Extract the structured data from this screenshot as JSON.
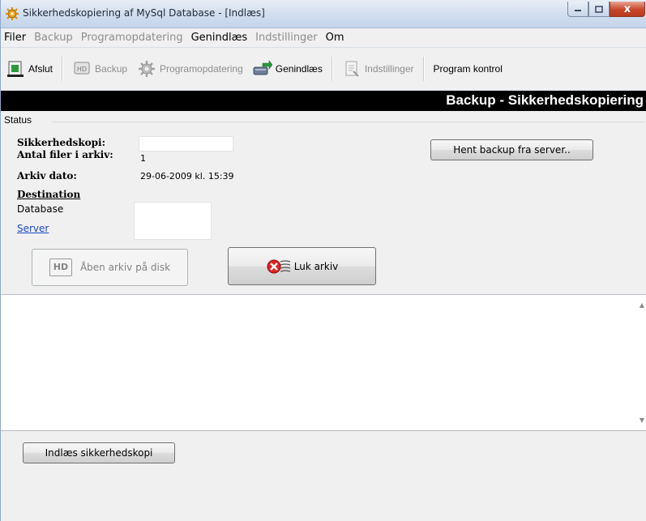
{
  "window": {
    "title": "Sikkerhedskopiering af MySql Database - [Indlæs]",
    "close_glyph": "x"
  },
  "menu": {
    "items": [
      {
        "label": "Filer",
        "enabled": true
      },
      {
        "label": "Backup",
        "enabled": false
      },
      {
        "label": "Programopdatering",
        "enabled": false
      },
      {
        "label": "Genindlæs",
        "enabled": true
      },
      {
        "label": "Indstillinger",
        "enabled": false
      },
      {
        "label": "Om",
        "enabled": true
      }
    ]
  },
  "toolbar": {
    "afslut": "Afslut",
    "backup": "Backup",
    "programopdatering": "Programopdatering",
    "genindlaes": "Genindlæs",
    "indstillinger": "Indstillinger",
    "program_kontrol": "Program kontrol"
  },
  "header": {
    "title": "Backup - Sikkerhedskopiering"
  },
  "status": {
    "legend": "Status",
    "sikkerhedskopi_label": "Sikkerhedskopi:",
    "sikkerhedskopi_value": "",
    "antal_label": "Antal filer i arkiv:",
    "antal_value": "1",
    "arkiv_dato_label": "Arkiv dato:",
    "arkiv_dato_value": "29-06-2009 kl. 15:39",
    "destination_label": "Destination",
    "database_label": "Database",
    "server_link": "Server",
    "hent_button": "Hent backup fra server..",
    "aaben_button": "Åben arkiv på disk",
    "luk_button": "Luk arkiv",
    "hd_badge": "HD"
  },
  "log": {
    "text": ""
  },
  "bottom": {
    "indlaes_button": "Indlæs sikkerhedskopi"
  },
  "colors": {
    "header_bg": "#000000",
    "link": "#1c48c8",
    "close": "#c8452a"
  }
}
